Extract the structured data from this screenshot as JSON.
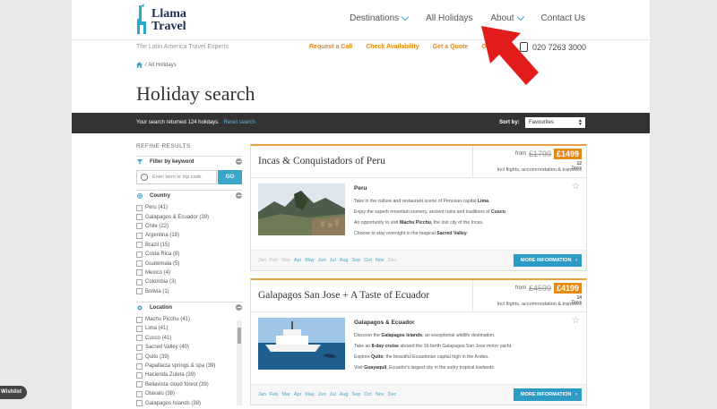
{
  "logo": {
    "line1": "Llama",
    "line2": "Travel"
  },
  "nav": [
    {
      "label": "Destinations",
      "dropdown": true
    },
    {
      "label": "All Holidays",
      "dropdown": false
    },
    {
      "label": "About",
      "dropdown": true
    },
    {
      "label": "Contact Us",
      "dropdown": false
    }
  ],
  "subbar": {
    "tagline": "The Latin America Travel Experts",
    "links": [
      "Request a Call",
      "Check Availability",
      "Get a Quote",
      "Order a"
    ],
    "phone": "020 7263 3000"
  },
  "breadcrumb": {
    "current": "All Holidays"
  },
  "page_title": "Holiday search",
  "results": {
    "text": "Your search returned 124 holidays.",
    "reset": "Reset search",
    "sort_label": "Sort by:",
    "sort_value": "Favourites"
  },
  "sidebar": {
    "refine": "REFINE RESULTS",
    "keyword_title": "Filter by keyword",
    "keyword_placeholder": "Enter term or trip code",
    "go": "GO",
    "country_title": "Country",
    "countries": [
      "Peru (41)",
      "Galapagos & Ecuador (39)",
      "Chile (22)",
      "Argentina (18)",
      "Brazil (15)",
      "Costa Rica (8)",
      "Guatemala (5)",
      "Mexico (4)",
      "Colombia (3)",
      "Bolivia (1)"
    ],
    "location_title": "Location",
    "locations": [
      "Machu Picchu (41)",
      "Lima (41)",
      "Cusco (41)",
      "Sacred Valley (40)",
      "Quito (39)",
      "Papallacta springs & spa (39)",
      "Hacienda Zuleta (39)",
      "Bellavista cloud forest (39)",
      "Otavalo (38)",
      "Galapagos Islands (38)"
    ]
  },
  "months": [
    "Jan",
    "Feb",
    "Mar",
    "Apr",
    "May",
    "Jun",
    "Jul",
    "Aug",
    "Sep",
    "Oct",
    "Nov",
    "Dec"
  ],
  "holidays": [
    {
      "title": "Incas & Conquistadors of Peru",
      "from": "from",
      "was": "£1799",
      "price": "£1499",
      "days_num": "12",
      "days_label": "Days",
      "incl": "Incl flights, accommodation & transfers",
      "destination": "Peru",
      "bullets": [
        {
          "pre": "Take in the culture and restaurant scene of Peruvian capital ",
          "bold": "Lima",
          "post": "."
        },
        {
          "pre": "Enjoy the superb mountain scenery, ancient ruins and traditions of ",
          "bold": "Cusco",
          "post": "."
        },
        {
          "pre": "An opportunity to visit ",
          "bold": "Machu Picchu",
          "post": ", the lost city of the Incas."
        },
        {
          "pre": "Choose to stay overnight in the magical ",
          "bold": "Sacred Valley",
          "post": "."
        }
      ],
      "more": "MORE INFORMATION",
      "active_months": [
        3,
        4,
        5,
        6,
        7,
        8,
        9,
        10
      ]
    },
    {
      "title": "Galapagos San Jose + A Taste of Ecuador",
      "from": "from",
      "was": "£4599",
      "price": "£4199",
      "days_num": "14",
      "days_label": "Days",
      "incl": "Incl flights, accommodation & transfers",
      "destination": "Galapagos & Ecuador",
      "bullets": [
        {
          "pre": "Discover the ",
          "bold": "Galapagos Islands",
          "post": ", an exceptional wildlife destination."
        },
        {
          "pre": "Take an ",
          "bold": "8-day cruise",
          "post": " aboard the 16-berth Galapagos San Jose motor yacht."
        },
        {
          "pre": "Explore ",
          "bold": "Quito",
          "post": ", the beautiful Ecuadorian capital high in the Andes."
        },
        {
          "pre": "Visit ",
          "bold": "Guayaquil",
          "post": ", Ecuador's largest city in the sultry tropical lowlands."
        }
      ],
      "more": "MORE INFORMATION",
      "active_months": [
        0,
        1,
        2,
        3,
        4,
        5,
        6,
        7,
        8,
        9,
        10,
        11
      ]
    }
  ],
  "wishlist": "Wishlist",
  "colors": {
    "accent_blue": "#3aa6c8",
    "accent_orange": "#e58a12",
    "dark_bar": "#333333",
    "annotation_red": "#e21b1b"
  }
}
